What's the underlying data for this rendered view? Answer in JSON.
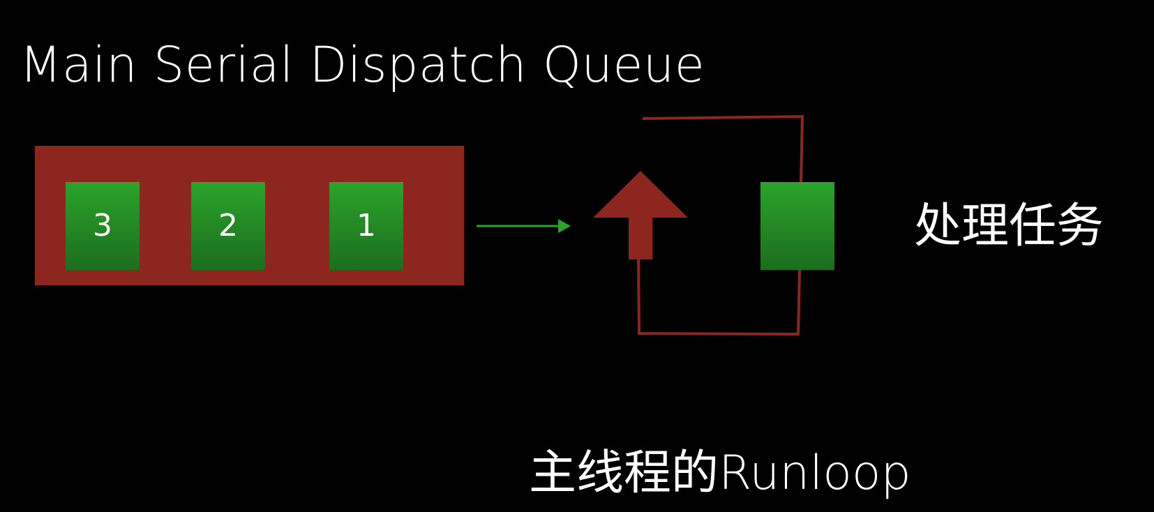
{
  "title": "Main Serial Dispatch Queue",
  "queue": {
    "tasks": [
      {
        "label": "3"
      },
      {
        "label": "2"
      },
      {
        "label": "1"
      }
    ]
  },
  "runloop": {
    "process_label": "处理任务",
    "caption": "主线程的Runloop"
  },
  "colors": {
    "background": "#000000",
    "queue_fill": "#8e2620",
    "task_fill": "#24922a",
    "arrow_green": "#2aa42a",
    "loop_red": "#8e2620",
    "text": "#ffffff"
  }
}
